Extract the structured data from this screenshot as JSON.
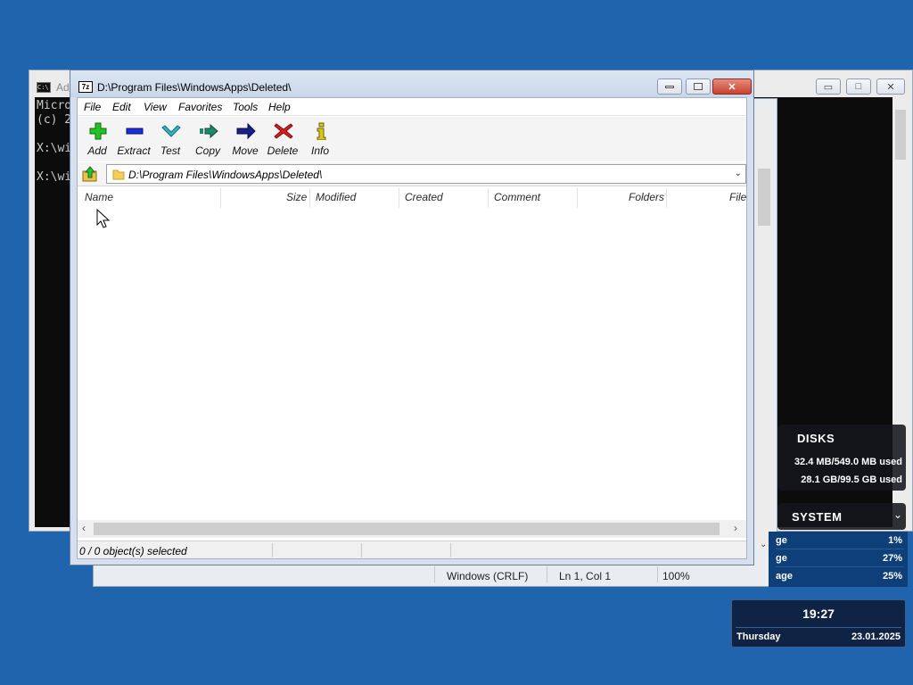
{
  "console": {
    "title": "Ad",
    "lines": [
      "Micro",
      "(c) 2",
      "",
      "X:\\wi",
      "",
      "X:\\wi"
    ]
  },
  "notepad": {
    "status_encoding": "Windows (CRLF)",
    "status_position": "Ln 1, Col 1",
    "status_zoom": "100%"
  },
  "gadgets": {
    "disks": {
      "header": "DISKS",
      "rows": [
        "32.4 MB/549.0 MB used",
        "28.1 GB/99.5 GB used"
      ]
    },
    "system": {
      "header": "SYSTEM",
      "rows": [
        {
          "label": "ge",
          "value": "1%"
        },
        {
          "label": "ge",
          "value": "27%"
        },
        {
          "label": "age",
          "value": "25%"
        }
      ]
    },
    "clock": {
      "time": "19:27",
      "day": "Thursday",
      "date": "23.01.2025"
    }
  },
  "zip": {
    "app_icon": "7z",
    "title": "D:\\Program Files\\WindowsApps\\Deleted\\",
    "menu": [
      "File",
      "Edit",
      "View",
      "Favorites",
      "Tools",
      "Help"
    ],
    "toolbar": [
      {
        "label": "Add",
        "icon": "plus-icon",
        "color": "#22c222"
      },
      {
        "label": "Extract",
        "icon": "minus-icon",
        "color": "#1a2fd8"
      },
      {
        "label": "Test",
        "icon": "check-icon",
        "color": "#2fb7c8"
      },
      {
        "label": "Copy",
        "icon": "copy-arrow-icon",
        "color": "#1e8a6a"
      },
      {
        "label": "Move",
        "icon": "move-arrow-icon",
        "color": "#1a1f8a"
      },
      {
        "label": "Delete",
        "icon": "x-icon",
        "color": "#d81e1e"
      },
      {
        "label": "Info",
        "icon": "info-icon",
        "color": "#d8c81e"
      }
    ],
    "address": "D:\\Program Files\\WindowsApps\\Deleted\\",
    "columns": [
      "Name",
      "Size",
      "Modified",
      "Created",
      "Comment",
      "Folders",
      "File"
    ],
    "status": "0 / 0 object(s) selected"
  }
}
